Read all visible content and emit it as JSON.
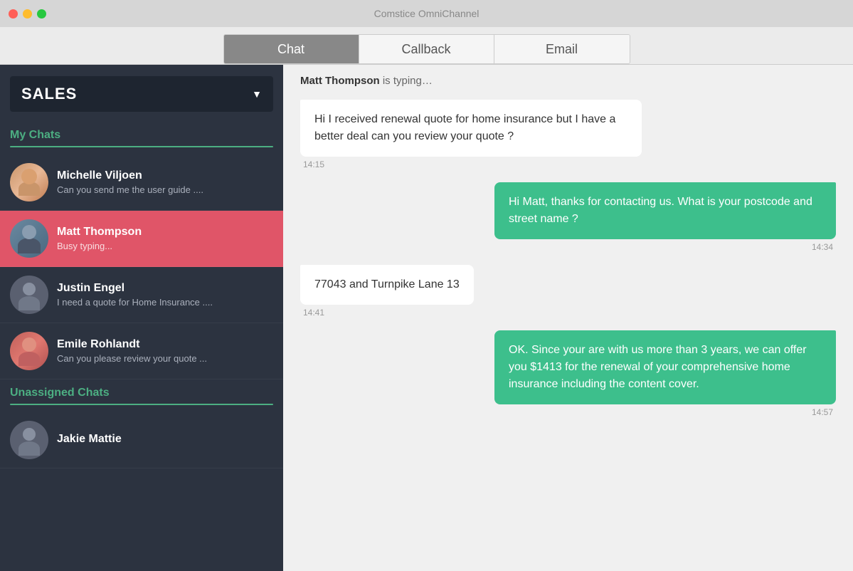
{
  "titleBar": {
    "title": "Comstice OmniChannel"
  },
  "tabs": [
    {
      "id": "chat",
      "label": "Chat",
      "active": true
    },
    {
      "id": "callback",
      "label": "Callback",
      "active": false
    },
    {
      "id": "email",
      "label": "Email",
      "active": false
    }
  ],
  "sidebar": {
    "queueLabel": "SALES",
    "myChatsSectionLabel": "My Chats",
    "unassignedSectionLabel": "Unassigned Chats",
    "myChats": [
      {
        "id": "michelle",
        "name": "Michelle Viljoen",
        "preview": "Can you send me the user guide ....",
        "avatarClass": "avatar-michelle",
        "active": false
      },
      {
        "id": "matt",
        "name": "Matt Thompson",
        "preview": "Busy typing...",
        "avatarClass": "avatar-matt",
        "active": true
      },
      {
        "id": "justin",
        "name": "Justin Engel",
        "preview": "I need a quote for Home Insurance ....",
        "avatarClass": "avatar-justin",
        "active": false
      },
      {
        "id": "emile",
        "name": "Emile Rohlandt",
        "preview": "Can you please review your quote ...",
        "avatarClass": "avatar-emile",
        "active": false
      }
    ],
    "unassignedChats": [
      {
        "id": "jakie",
        "name": "Jakie Mattie",
        "preview": "",
        "avatarClass": "avatar-jakie",
        "active": false
      }
    ]
  },
  "chatArea": {
    "typingIndicator": {
      "name": "Matt Thompson",
      "text": " is typing…"
    },
    "messages": [
      {
        "id": "msg1",
        "direction": "incoming",
        "text": "Hi I received renewal quote for home insurance but I have a better deal can you review your quote ?",
        "time": "14:15"
      },
      {
        "id": "msg2",
        "direction": "outgoing",
        "text": "Hi Matt, thanks for  contacting us. What is your postcode and street name ?",
        "time": "14:34"
      },
      {
        "id": "msg3",
        "direction": "incoming",
        "text": "77043 and  Turnpike Lane 13",
        "time": "14:41"
      },
      {
        "id": "msg4",
        "direction": "outgoing",
        "text": "OK. Since your are with us more than 3 years, we can offer you $1413 for the renewal of your comprehensive home insurance including the content cover.",
        "time": "14:57"
      }
    ]
  }
}
